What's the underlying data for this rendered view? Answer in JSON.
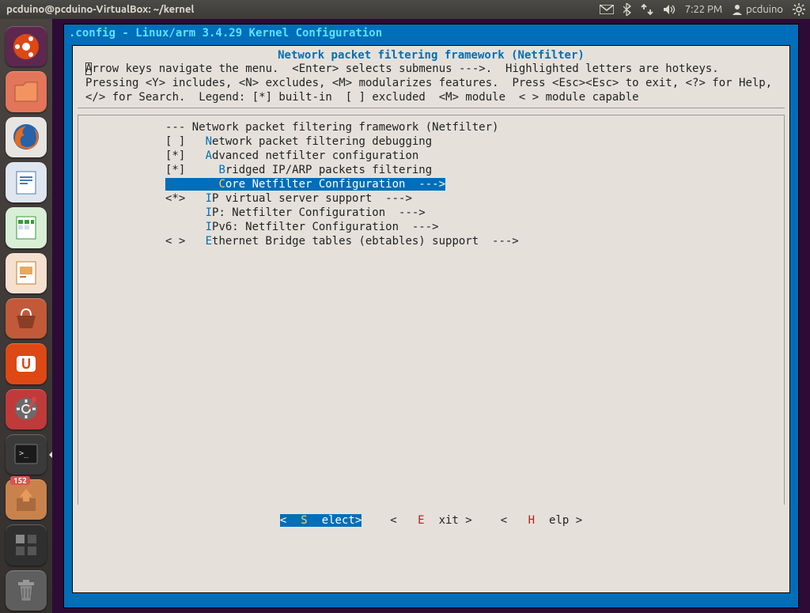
{
  "panel": {
    "window_title": "pcduino@pcduino-VirtualBox: ~/kernel",
    "time": "7:22 PM",
    "user": "pcduino"
  },
  "launcher": {
    "items": [
      {
        "name": "dash",
        "bg": "#5e2750",
        "badge": ""
      },
      {
        "name": "files",
        "bg": "#e2755a",
        "badge": ""
      },
      {
        "name": "firefox",
        "bg": "#e7e5e2",
        "badge": ""
      },
      {
        "name": "writer",
        "bg": "#dfe6ef",
        "badge": ""
      },
      {
        "name": "calc",
        "bg": "#d8efd6",
        "badge": ""
      },
      {
        "name": "impress",
        "bg": "#f5e0cf",
        "badge": ""
      },
      {
        "name": "software-center",
        "bg": "#c25a3a",
        "badge": ""
      },
      {
        "name": "ubuntu-one",
        "bg": "#dd4814",
        "badge": ""
      },
      {
        "name": "settings",
        "bg": "#c03a3a",
        "badge": ""
      },
      {
        "name": "terminal",
        "bg": "#3a3a3a",
        "badge": "",
        "active": true
      },
      {
        "name": "updates",
        "bg": "#c9824c",
        "badge": "152"
      },
      {
        "name": "workspaces",
        "bg": "#2f2f2f",
        "badge": ""
      },
      {
        "name": "trash",
        "bg": "#5e5e5e",
        "badge": ""
      }
    ]
  },
  "terminal": {
    "config_line": ".config - Linux/arm 3.4.29 Kernel Configuration",
    "dialog_title": "Network packet filtering framework (Netfilter)",
    "help_text": "Arrow keys navigate the menu.  <Enter> selects submenus --->.  Highlighted letters are hotkeys.  Pressing <Y> includes, <N> excludes, <M> modularizes features.  Press <Esc><Esc> to exit, <?> for Help, </> for Search.  Legend: [*] built-in  [ ] excluded  <M> module  < > module capable",
    "menu": [
      {
        "sym": "--- ",
        "hot": "",
        "label": "Network packet filtering framework (Netfilter)",
        "selected": false
      },
      {
        "sym": "[ ]   ",
        "hot": "N",
        "label": "etwork packet filtering debugging",
        "selected": false
      },
      {
        "sym": "[*]   ",
        "hot": "A",
        "label": "dvanced netfilter configuration",
        "selected": false
      },
      {
        "sym": "[*]     ",
        "hot": "B",
        "label": "ridged IP/ARP packets filtering",
        "selected": false
      },
      {
        "sym": "        ",
        "hot": "C",
        "label": "ore Netfilter Configuration  --->",
        "selected": true
      },
      {
        "sym": "<*>   ",
        "hot": "I",
        "label": "P virtual server support  --->",
        "selected": false
      },
      {
        "sym": "      ",
        "hot": "I",
        "label": "P: Netfilter Configuration  --->",
        "selected": false
      },
      {
        "sym": "      ",
        "hot": "I",
        "label": "Pv6: Netfilter Configuration  --->",
        "selected": false
      },
      {
        "sym": "< >   ",
        "hot": "E",
        "label": "thernet Bridge tables (ebtables) support  --->",
        "selected": false
      }
    ],
    "buttons": {
      "select": "<Select>",
      "exit_pre": "< E",
      "exit_post": "xit >",
      "help_pre": "< H",
      "help_post": "elp >"
    }
  }
}
